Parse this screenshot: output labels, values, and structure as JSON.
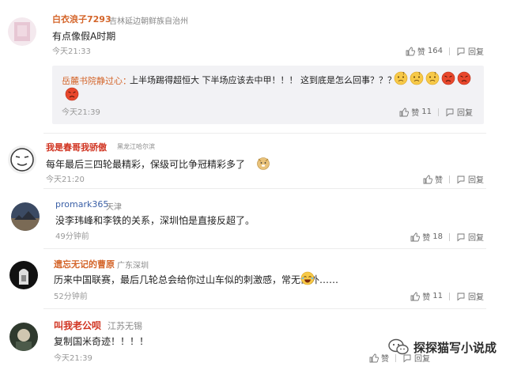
{
  "comments": [
    {
      "username": "白衣浪子7293",
      "location": "吉林延边朝鲜族自治州",
      "text": "有点像假A时期",
      "time": "今天21:33",
      "like_label": "赞",
      "likes": "164",
      "reply_label": "回复",
      "reply": {
        "username": "岳麓书院静过心：",
        "text": "上半场踢得超恒大  下半场应该去中甲！！！   这到底是怎么回事？？？",
        "time": "今天21:39",
        "like_label": "赞",
        "likes": "11",
        "reply_label": "回复"
      }
    },
    {
      "username": "我是春哥我骄傲",
      "location": "黑龙江哈尔滨",
      "text": "每年最后三四轮最精彩，保级可比争冠精彩多了",
      "time": "今天21:20",
      "like_label": "赞",
      "likes": "",
      "reply_label": "回复"
    },
    {
      "username": "promark365",
      "location": "天津",
      "text": "没李玮峰和李铁的关系，深圳怕是直接反超了。",
      "time": "49分钟前",
      "like_label": "赞",
      "likes": "18",
      "reply_label": "回复"
    },
    {
      "username": "遗忘无记的曹原",
      "location": "广东深圳",
      "text": "历来中国联赛，最后几轮总会给你过山车似的刺激感，常无例外……",
      "time": "52分钟前",
      "like_label": "赞",
      "likes": "11",
      "reply_label": "回复"
    },
    {
      "username": "叫我老公呗",
      "location": "江苏无锡",
      "text": "复制国米奇迹！！！！",
      "time": "今天21:39",
      "like_label": "赞",
      "likes": "",
      "reply_label": "回复"
    }
  ],
  "watermark": "探探猫写小说成",
  "colors": {
    "username_orange": "#d4652a",
    "username_red": "#d0321f",
    "username_blue": "#3a5fa6",
    "reply_bg": "#f2f2f5"
  }
}
